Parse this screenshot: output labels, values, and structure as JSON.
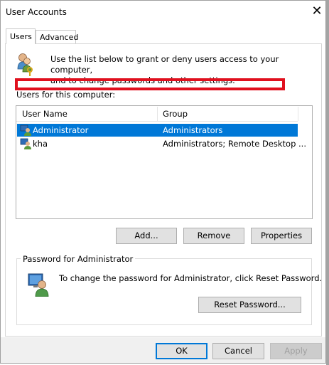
{
  "window": {
    "title": "User Accounts"
  },
  "tabs": [
    {
      "label": "Users"
    },
    {
      "label": "Advanced"
    }
  ],
  "intro_text_line1": "Use the list below to grant or deny users access to your computer,",
  "intro_text_line2": "and to change passwords and other settings.",
  "users_section_label": "Users for this computer:",
  "table": {
    "columns": [
      "User Name",
      "Group"
    ],
    "rows": [
      {
        "name": "Administrator",
        "group": "Administrators",
        "selected": true
      },
      {
        "name": "kha",
        "group": "Administrators; Remote Desktop ...",
        "selected": false
      }
    ]
  },
  "buttons": {
    "add": "Add...",
    "remove": "Remove",
    "properties": "Properties",
    "reset_password": "Reset Password...",
    "ok": "OK",
    "cancel": "Cancel",
    "apply": "Apply"
  },
  "password_group": {
    "title": "Password for Administrator",
    "text": "To change the password for Administrator, click Reset Password."
  },
  "icons": {
    "users": "users-key-icon",
    "user_row": "user-icon",
    "password_user": "user-monitor-icon",
    "close": "close-icon"
  },
  "colors": {
    "selection": "#0078d7",
    "highlight_box": "#e0101e"
  }
}
